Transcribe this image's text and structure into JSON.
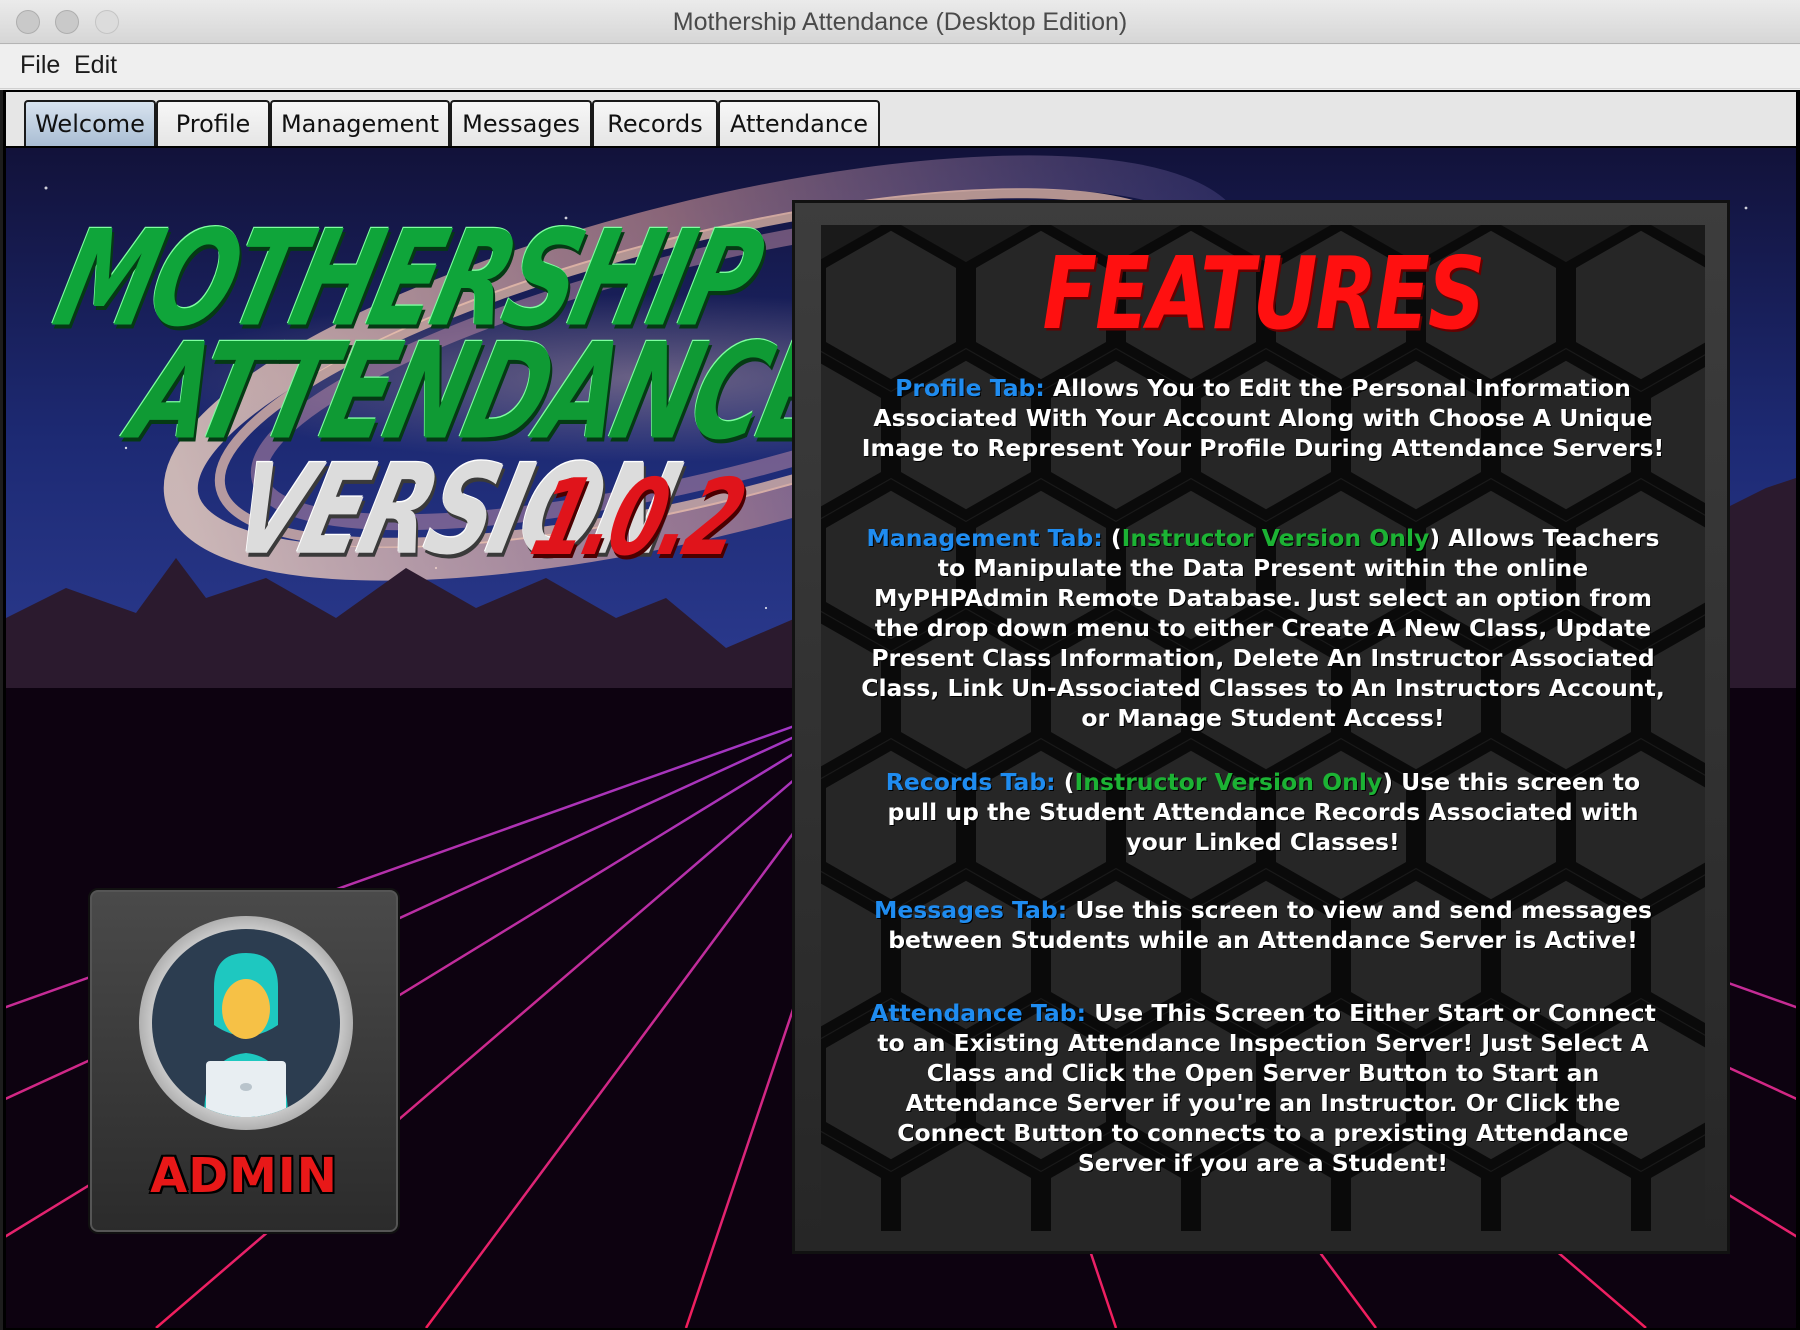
{
  "window": {
    "title": "Mothership Attendance (Desktop Edition)"
  },
  "menu": {
    "file": "File",
    "edit": "Edit"
  },
  "tabs": [
    "Welcome",
    "Profile",
    "Management",
    "Messages",
    "Records",
    "Attendance"
  ],
  "active_tab": "Welcome",
  "logo": {
    "line1": "MOTHERSHIP",
    "line2": "ATTENDANCE",
    "line3": "VERSION",
    "line4": "1.0.2"
  },
  "profile": {
    "role": "ADMIN"
  },
  "features": {
    "title": "FEATURES",
    "profile": {
      "key": "Profile Tab:",
      "text": " Allows You to Edit the Personal Information Associated With Your Account Along with Choose A Unique Image to Represent Your Profile During Attendance Servers!"
    },
    "management": {
      "key": "Management Tab:",
      "paren_open": " (",
      "note": "Instructor Version Only",
      "text": ") Allows Teachers to Manipulate the Data Present within the online MyPHPAdmin Remote Database. Just select an option from the drop down menu to either Create A New Class, Update Present Class Information, Delete An Instructor Associated Class, Link Un-Associated Classes to An Instructors Account, or Manage Student Access!"
    },
    "records": {
      "key": "Records Tab:",
      "paren_open": " (",
      "note": "Instructor Version Only",
      "text": ") Use this screen to pull up the Student Attendance Records Associated with your Linked Classes!"
    },
    "messages": {
      "key": "Messages Tab:",
      "text": " Use this screen to view and send messages between Students while an Attendance Server is Active!"
    },
    "attendance": {
      "key": "Attendance Tab:",
      "text": " Use This Screen to Either Start or Connect to an Existing Attendance Inspection Server! Just Select A Class and Click the Open Server Button to Start an Attendance Server if you're an Instructor. Or Click the Connect Button to connects to a prexisting Attendance Server if you are a Student!"
    }
  },
  "colors": {
    "key_blue": "#1f8cf0",
    "note_green": "#1cb334",
    "title_red": "#ff1010",
    "logo_green": "#0fa53a",
    "version_red": "#e0141b",
    "grid_pink": "#ff2a7a"
  }
}
